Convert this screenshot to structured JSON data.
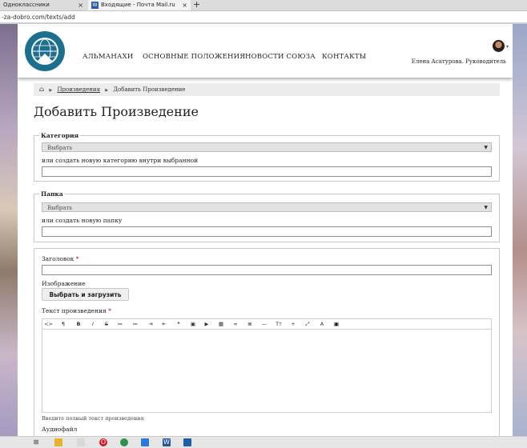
{
  "browser": {
    "tabs": [
      {
        "label": "Одноклассники",
        "close": "×"
      },
      {
        "label": "Входящие - Почта Mail.ru",
        "close": "×",
        "favicon": "W"
      }
    ],
    "new_tab": "+",
    "url": "-za-dobro.com/texts/add"
  },
  "header": {
    "nav": [
      "АЛЬМАНАХИ",
      "ОСНОВНЫЕ ПОЛОЖЕНИЯ",
      "НОВОСТИ СОЮЗА",
      "КОНТАКТЫ"
    ],
    "user": "Елена Асатурова. Руководитель"
  },
  "breadcrumb": {
    "home_icon": "⌂",
    "separator": "▶",
    "items": [
      "Произведения",
      "Добавить Произведение"
    ]
  },
  "page_title": "Добавить Произведение",
  "category": {
    "legend": "Категория",
    "select_value": "Выбрать",
    "new_label": "или создать новую категорию внутри выбранной"
  },
  "folder": {
    "legend": "Папка",
    "select_value": "Выбрать",
    "new_label": "или создать новую папку"
  },
  "form": {
    "title_label": "Заголовок",
    "required_mark": "*",
    "image_label": "Изображение",
    "upload_button": "Выбрать и загрузить",
    "text_label": "Текст произведения",
    "helper": "Введите полный текст произведения",
    "audio_label": "Аудиофайл"
  },
  "editor_toolbar": [
    "<>",
    "¶",
    "B",
    "I",
    "S",
    "≔",
    "≔",
    "⇥",
    "⇤",
    "❝",
    "▣",
    "▶",
    "▦",
    "∞",
    "≣",
    "—",
    "Tт",
    "+",
    "⤢",
    "A",
    "▣"
  ],
  "colors": {
    "accent": "#1d6f8e",
    "required": "#cc0000",
    "header_bg": "#ffffff",
    "breadcrumb_bg": "#ececec"
  }
}
